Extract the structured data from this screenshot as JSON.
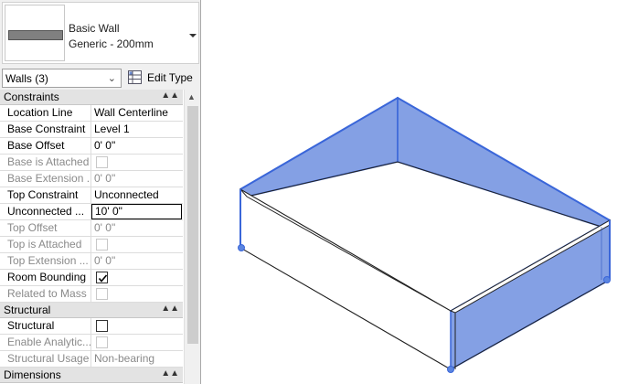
{
  "type_selector": {
    "family": "Basic Wall",
    "type_name": "Generic - 200mm",
    "icon": "wall-type-swatch-icon"
  },
  "filter": {
    "label": "Walls (3)",
    "edit_type_label": "Edit Type",
    "edit_type_icon": "edit-type-icon"
  },
  "groups": {
    "constraints": {
      "title": "Constraints",
      "rows": [
        {
          "name": "Location Line",
          "value": "Wall Centerline"
        },
        {
          "name": "Base Constraint",
          "value": "Level 1"
        },
        {
          "name": "Base Offset",
          "value": "0'  0\""
        },
        {
          "name": "Base is Attached",
          "value": ""
        },
        {
          "name": "Base Extension ...",
          "value": "0'  0\""
        },
        {
          "name": "Top Constraint",
          "value": "Unconnected"
        },
        {
          "name": "Unconnected ...",
          "value": "10'  0\""
        },
        {
          "name": "Top Offset",
          "value": "0'  0\""
        },
        {
          "name": "Top is Attached",
          "value": ""
        },
        {
          "name": "Top Extension ...",
          "value": "0'  0\""
        },
        {
          "name": "Room Bounding",
          "value": ""
        },
        {
          "name": "Related to Mass",
          "value": ""
        }
      ]
    },
    "structural": {
      "title": "Structural",
      "rows": [
        {
          "name": "Structural",
          "value": ""
        },
        {
          "name": "Enable Analytic...",
          "value": ""
        },
        {
          "name": "Structural Usage",
          "value": "Non-bearing"
        }
      ]
    },
    "dimensions": {
      "title": "Dimensions"
    }
  },
  "colors": {
    "selection_blue": "#3a66d9",
    "selection_fill": "#6f8fdf"
  }
}
